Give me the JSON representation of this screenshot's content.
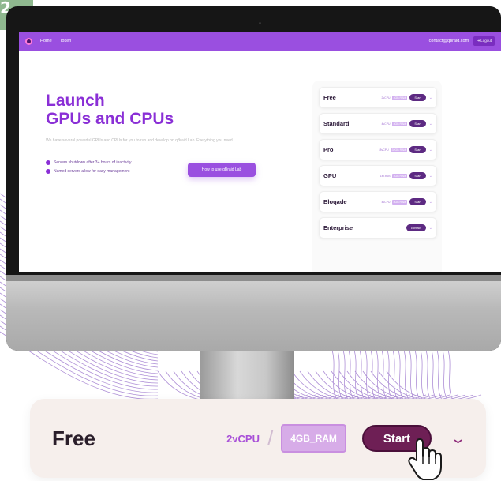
{
  "step": {
    "number": "2"
  },
  "colors": {
    "accent": "#9a4fe0",
    "brand_dark": "#6e1f55",
    "badge": "#8fb88f"
  },
  "app": {
    "nav": {
      "links": [
        "Home",
        "Token"
      ],
      "email": "contact@qbraid.com",
      "logout": "⇥ Logout"
    },
    "hero": {
      "title_line1": "Launch",
      "title_line2": "GPUs and CPUs",
      "subtitle": "We have several powerful GPUs and CPUs for you to run and develop on qBraid Lab. Everything you need.",
      "bullets": [
        "Servers shutdown after 3+ hours of inactivity",
        "Named servers allow for easy management"
      ],
      "howto_button": "How to use qBraid Lab"
    },
    "plans": [
      {
        "name": "Free",
        "cpu": "2vCPU",
        "ram": "4GB RAM",
        "action": "Start"
      },
      {
        "name": "Standard",
        "cpu": "4vCPU",
        "ram": "8GB RAM",
        "action": "Start"
      },
      {
        "name": "Pro",
        "cpu": "8vCPU",
        "ram": "32GB RAM",
        "action": "Start"
      },
      {
        "name": "GPU",
        "cpu": "1xT4GB",
        "ram": "4GB RAM",
        "action": "Start"
      },
      {
        "name": "Bloqade",
        "cpu": "4vCPU",
        "ram": "8GB RAM",
        "action": "Start"
      },
      {
        "name": "Enterprise",
        "cpu": "",
        "ram": "",
        "action": "contact"
      }
    ]
  },
  "zoom": {
    "plan": "Free",
    "cpu": "2vCPU",
    "separator": "/",
    "ram": "4GB_RAM",
    "start": "Start",
    "chevron": "⌄"
  },
  "icons": {
    "cursor": "hand-pointer-icon",
    "expand": "chevron-down-icon",
    "logo": "qbraid-logo-icon"
  }
}
